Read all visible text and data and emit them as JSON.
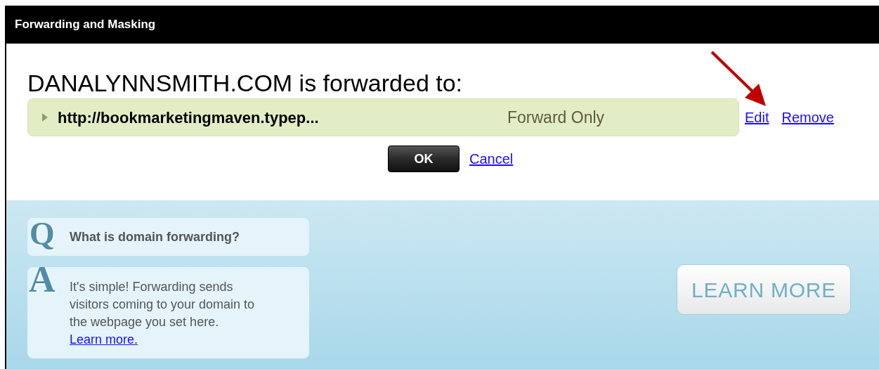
{
  "window": {
    "title": "Forwarding and Masking"
  },
  "heading": "DANALYNNSMITH.COM is forwarded to:",
  "forward": {
    "url": "http://bookmarketingmaven.typep...",
    "type": "Forward Only",
    "expanded": false,
    "links": [
      "Edit",
      "Remove"
    ]
  },
  "buttons": {
    "ok": "OK",
    "cancel": "Cancel"
  },
  "faq": {
    "question_mark": "Q",
    "question": "What is domain forwarding?",
    "answer_mark": "A",
    "answer": "It's simple! Forwarding sends visitors coming to your domain to the webpage you set here.",
    "answer_link": "Learn more."
  },
  "learn_more_button": "LEARN MORE"
}
